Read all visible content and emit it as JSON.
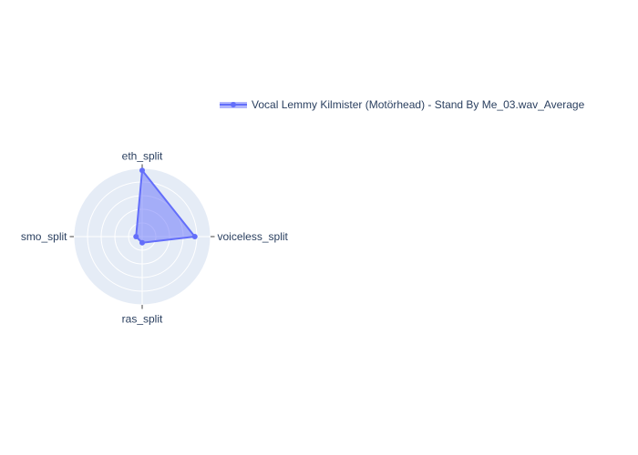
{
  "chart_data": {
    "type": "radar",
    "axes": [
      "eth_split",
      "voiceless_split",
      "ras_split",
      "smo_split"
    ],
    "radial_range": [
      0,
      1
    ],
    "grid": true,
    "legend_position": "top-right",
    "series": [
      {
        "name": "Vocal Lemmy Kilmister (Motörhead) - Stand By Me_03.wav_Average",
        "values": [
          0.97,
          0.77,
          0.09,
          0.09
        ],
        "color": "#636efa"
      }
    ]
  }
}
